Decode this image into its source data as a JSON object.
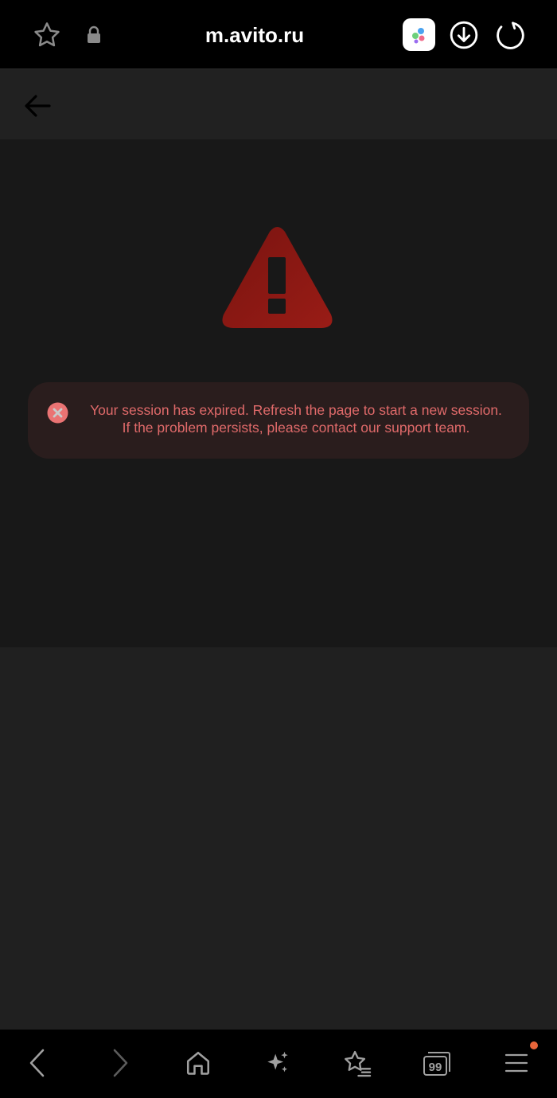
{
  "browser": {
    "url": "m.avito.ru",
    "tab_count": "99"
  },
  "alert": {
    "message_line1": "Your session has expired. Refresh the page to start a new session.",
    "message_line2": "If the problem persists, please contact our support team."
  },
  "icons": {
    "top": [
      "star-icon",
      "lock-icon",
      "app-icon",
      "download-icon",
      "reload-icon"
    ],
    "header": [
      "back-arrow-icon"
    ],
    "content": [
      "warning-icon",
      "error-icon"
    ],
    "bottom": [
      "back-icon",
      "forward-icon",
      "home-icon",
      "sparkle-icon",
      "bookmarks-icon",
      "tabs-icon",
      "menu-icon"
    ]
  },
  "colors": {
    "warning_red": "#8e1a14",
    "alert_text": "#e06a6a",
    "alert_bg": "#2a1d1d",
    "notify_dot": "#e8653a"
  }
}
